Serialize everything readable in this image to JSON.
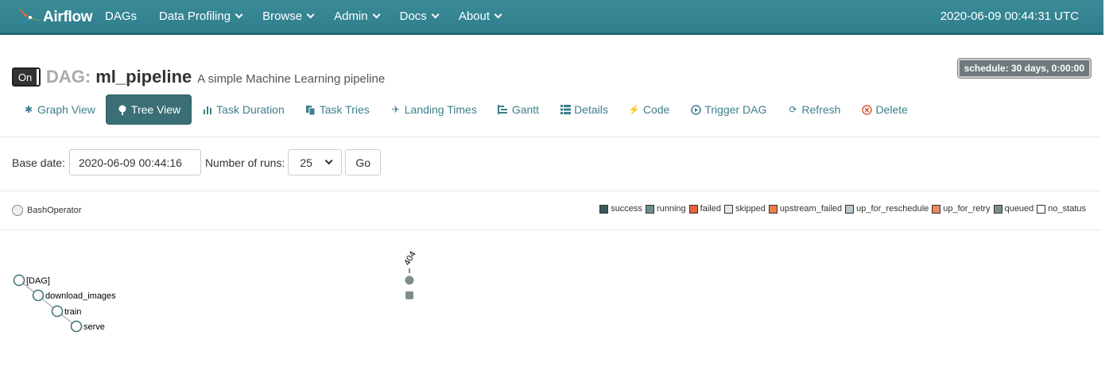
{
  "navbar": {
    "brand": "Airflow",
    "items": [
      {
        "label": "DAGs",
        "dropdown": false
      },
      {
        "label": "Data Profiling",
        "dropdown": true
      },
      {
        "label": "Browse",
        "dropdown": true
      },
      {
        "label": "Admin",
        "dropdown": true
      },
      {
        "label": "Docs",
        "dropdown": true
      },
      {
        "label": "About",
        "dropdown": true
      }
    ],
    "clock": "2020-06-09 00:44:31 UTC"
  },
  "dag": {
    "toggle_label": "On",
    "prefix": "DAG:",
    "name": "ml_pipeline",
    "description": "A simple Machine Learning pipeline",
    "schedule": "schedule: 30 days, 0:00:00"
  },
  "tabs": [
    {
      "label": "Graph View",
      "icon": "asterisk-icon"
    },
    {
      "label": "Tree View",
      "icon": "tree-icon",
      "active": true
    },
    {
      "label": "Task Duration",
      "icon": "bar-chart-icon"
    },
    {
      "label": "Task Tries",
      "icon": "files-icon"
    },
    {
      "label": "Landing Times",
      "icon": "plane-icon"
    },
    {
      "label": "Gantt",
      "icon": "gantt-icon"
    },
    {
      "label": "Details",
      "icon": "list-icon"
    },
    {
      "label": "Code",
      "icon": "flash-icon"
    },
    {
      "label": "Trigger DAG",
      "icon": "play-circle-icon"
    },
    {
      "label": "Refresh",
      "icon": "refresh-icon"
    },
    {
      "label": "Delete",
      "icon": "remove-circle-icon"
    }
  ],
  "form": {
    "base_date_label": "Base date:",
    "base_date_value": "2020-06-09 00:44:16",
    "runs_label": "Number of runs:",
    "runs_value": "25",
    "go_label": "Go"
  },
  "operator_legend": {
    "label": "BashOperator"
  },
  "state_legend": [
    {
      "label": "success",
      "color": "#3d5a5e"
    },
    {
      "label": "running",
      "color": "#6b8e8f"
    },
    {
      "label": "failed",
      "color": "#e8643a"
    },
    {
      "label": "skipped",
      "color": "#e8e8e8"
    },
    {
      "label": "upstream_failed",
      "color": "#e8804a"
    },
    {
      "label": "up_for_reschedule",
      "color": "#b8c8cc"
    },
    {
      "label": "up_for_retry",
      "color": "#e88a5a"
    },
    {
      "label": "queued",
      "color": "#7d8c8e"
    },
    {
      "label": "no_status",
      "color": "#ffffff"
    }
  ],
  "tree": {
    "run_label": "404",
    "nodes": [
      {
        "label": "[DAG]",
        "depth": 0
      },
      {
        "label": "download_images",
        "depth": 1
      },
      {
        "label": "train",
        "depth": 2
      },
      {
        "label": "serve",
        "depth": 3
      }
    ]
  }
}
